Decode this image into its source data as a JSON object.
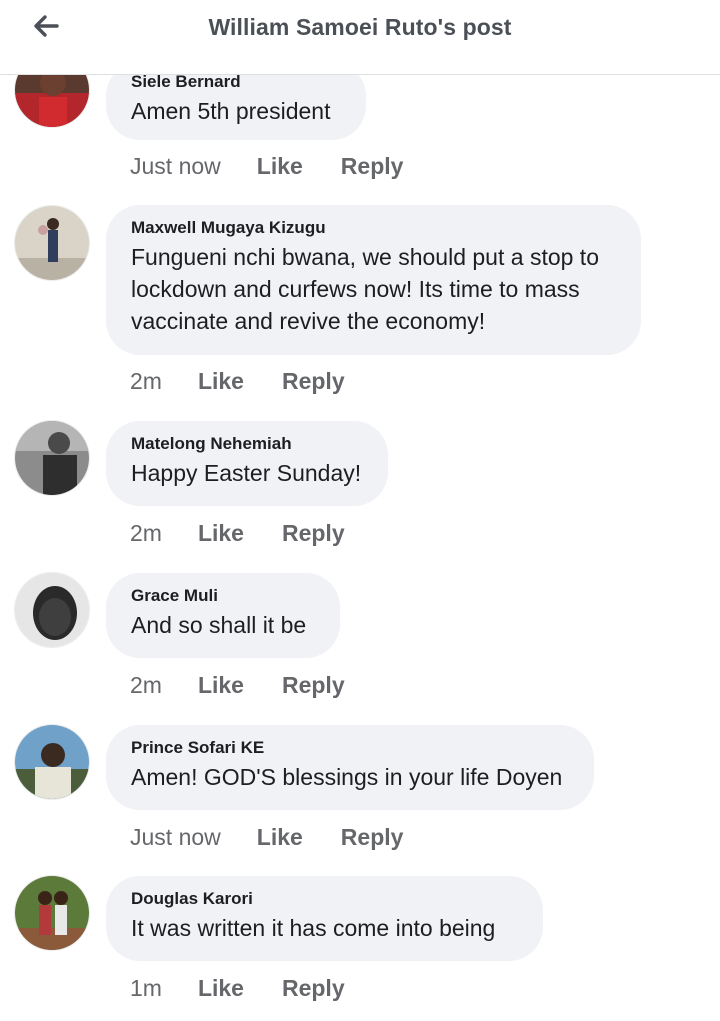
{
  "header": {
    "title": "William Samoei Ruto's post"
  },
  "comments": [
    {
      "author": "Siele Bernard",
      "text": "Amen 5th president",
      "time": "Just now",
      "like": "Like",
      "reply": "Reply"
    },
    {
      "author": "Maxwell Mugaya Kizugu",
      "text": "Fungueni nchi bwana, we should put a stop to lockdown and curfews now! Its time to mass vaccinate and revive the economy!",
      "time": "2m",
      "like": "Like",
      "reply": "Reply"
    },
    {
      "author": "Matelong Nehemiah",
      "text": "Happy Easter Sunday!",
      "time": "2m",
      "like": "Like",
      "reply": "Reply"
    },
    {
      "author": "Grace Muli",
      "text": "And so shall it be",
      "time": "2m",
      "like": "Like",
      "reply": "Reply"
    },
    {
      "author": "Prince Sofari KE",
      "text": "Amen! GOD'S blessings in your life Doyen",
      "time": "Just now",
      "like": "Like",
      "reply": "Reply"
    },
    {
      "author": "Douglas Karori",
      "text": "It was written it has come into being",
      "time": "1m",
      "like": "Like",
      "reply": "Reply"
    }
  ],
  "icons": {
    "back": "arrow-left-icon"
  }
}
